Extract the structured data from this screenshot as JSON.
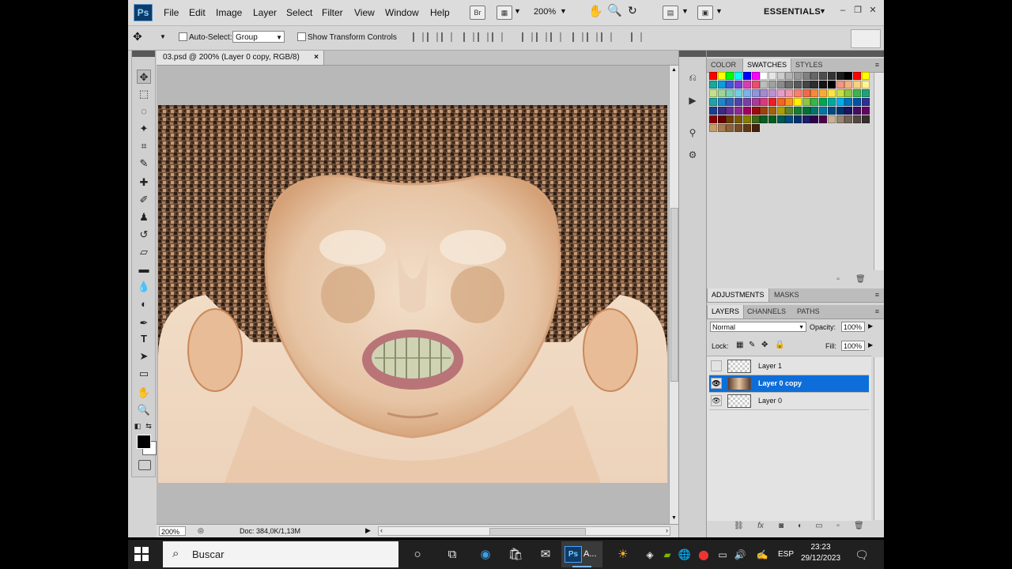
{
  "app": {
    "logo": "Ps",
    "menus": [
      "File",
      "Edit",
      "Image",
      "Layer",
      "Select",
      "Filter",
      "View",
      "Window",
      "Help"
    ],
    "zoom_menu": "200%",
    "workspace": "ESSENTIALS"
  },
  "options_bar": {
    "auto_select_label": "Auto-Select:",
    "auto_select_value": "Group",
    "show_transform_label": "Show Transform Controls"
  },
  "document": {
    "tab_title": "03.psd @ 200% (Layer 0 copy, RGB/8)",
    "tab_close": "×",
    "zoom": "200%",
    "doc_size": "Doc: 384,0K/1,13M"
  },
  "panels": {
    "top_tabs": [
      "COLOR",
      "SWATCHES",
      "STYLES"
    ],
    "mid_tabs": [
      "ADJUSTMENTS",
      "MASKS"
    ],
    "layer_tabs": [
      "LAYERS",
      "CHANNELS",
      "PATHS"
    ],
    "blend_mode": "Normal",
    "opacity_label": "Opacity:",
    "opacity_value": "100%",
    "lock_label": "Lock:",
    "fill_label": "Fill:",
    "fill_value": "100%",
    "layers": [
      {
        "name": "Layer 1",
        "visible": false,
        "selected": false
      },
      {
        "name": "Layer 0 copy",
        "visible": true,
        "selected": true
      },
      {
        "name": "Layer 0",
        "visible": true,
        "selected": false
      }
    ]
  },
  "swatches": {
    "row1": [
      "#ff0000",
      "#ffff00",
      "#00ff00",
      "#00ffff",
      "#0000ff",
      "#ff00ff",
      "#ffffff",
      "#e6e6e6",
      "#cccccc",
      "#b3b3b3",
      "#999999",
      "#808080",
      "#666666",
      "#4d4d4d",
      "#333333",
      "#1a1a1a",
      "#000000",
      "#ff0000",
      "#ffff00"
    ],
    "row2": [
      "#1aa89a",
      "#0b9ed9",
      "#3b5bd9",
      "#7b3bd9",
      "#d93bb3",
      "#ec4d6e",
      "#bdbdbd",
      "#a0a0a0",
      "#8a8a8a",
      "#6e6e6e",
      "#5a5a5a",
      "#454545",
      "#2f2f2f",
      "#141414",
      "#000000",
      "#f5957f",
      "#f7b07d",
      "#fbd07c",
      "#fff68f"
    ],
    "row3": [
      "#c5e08c",
      "#9fd39a",
      "#7ccfb5",
      "#72cfe0",
      "#7fb2e5",
      "#8f97d8",
      "#a38bd0",
      "#c08ed4",
      "#e59ccb",
      "#f297a8",
      "#f58170",
      "#f06a4a",
      "#f38a3c",
      "#f7ac3a",
      "#fce34a",
      "#c9de44",
      "#8dc63f",
      "#3fb34f",
      "#22a07a"
    ],
    "row4": [
      "#1fa3a5",
      "#1f86c6",
      "#2f61b9",
      "#4d43a8",
      "#7541a6",
      "#a53d99",
      "#d63a7f",
      "#ee1c24",
      "#f26522",
      "#f7941d",
      "#fff200",
      "#8dc63f",
      "#39b54a",
      "#00a651",
      "#00a99d",
      "#00aeef",
      "#0072bc",
      "#0054a6",
      "#2e3192"
    ],
    "row5": [
      "#1b3e8c",
      "#3a2a82",
      "#662d91",
      "#92278f",
      "#9e005d",
      "#9e0b0f",
      "#a0410d",
      "#a36209",
      "#aba000",
      "#598527",
      "#197b30",
      "#007236",
      "#00746b",
      "#0076a3",
      "#004a80",
      "#003471",
      "#1b1464",
      "#440e62",
      "#630460"
    ],
    "row6": [
      "#8a0000",
      "#640000",
      "#6b3d00",
      "#7a5a00",
      "#827f00",
      "#406618",
      "#0b5c24",
      "#005e20",
      "#005952",
      "#004a7f",
      "#00336b",
      "#1d1d6b",
      "#32004b",
      "#4b0049",
      "#c7b299",
      "#998675",
      "#736357",
      "#534741",
      "#362f2d"
    ],
    "row7": [
      "#c69c6d",
      "#a67c52",
      "#8c6239",
      "#754c24",
      "#603913",
      "#42210b"
    ]
  },
  "taskbar": {
    "search_placeholder": "Buscar",
    "ps_label": "A...",
    "language": "ESP",
    "time": "23:23",
    "date": "29/12/2023"
  }
}
